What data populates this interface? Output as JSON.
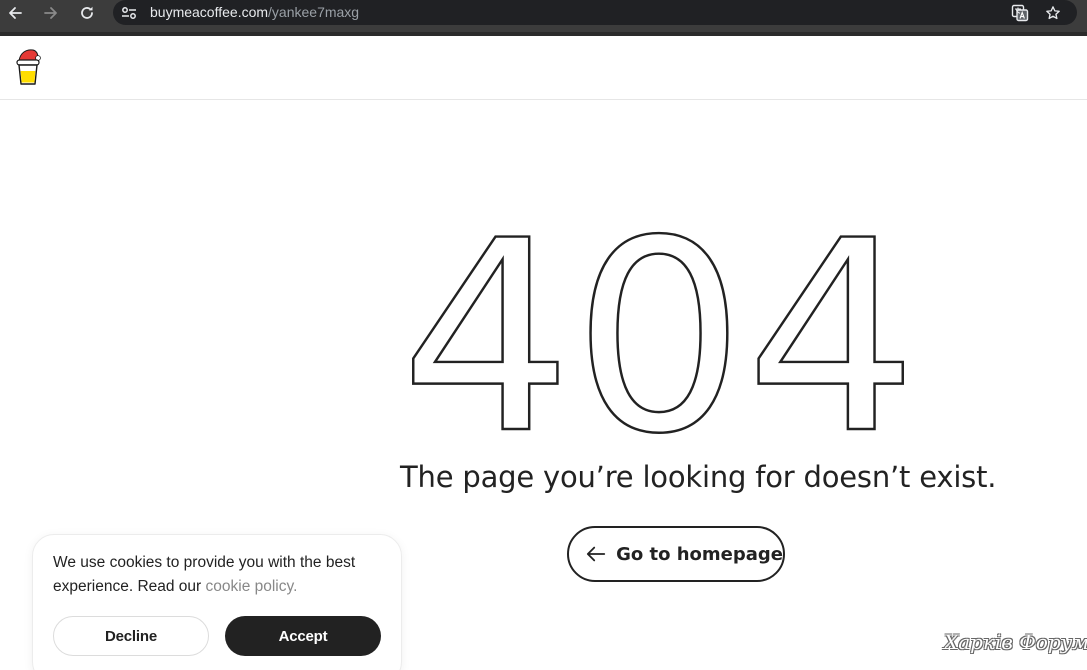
{
  "browser": {
    "url_host": "buymeacoffee.com",
    "url_path": "/yankee7maxg"
  },
  "error": {
    "code": "404",
    "message": "The page you’re looking for doesn’t exist.",
    "home_button_label": "Go to homepage"
  },
  "cookie_banner": {
    "text": "We use cookies to provide you with the best experience. Read our ",
    "link_text": "cookie policy.",
    "decline_label": "Decline",
    "accept_label": "Accept"
  },
  "watermark": {
    "text": "Харків Форум"
  },
  "icons": {
    "back": "arrow-left-icon",
    "forward": "arrow-right-icon",
    "reload": "reload-icon",
    "site_info": "tune-icon",
    "translate": "translate-icon",
    "bookmark": "star-icon",
    "home_arrow": "arrow-left-icon",
    "logo": "coffee-cup-logo"
  },
  "colors": {
    "text": "#222222",
    "link": "#888888",
    "accept_bg": "#222222",
    "chrome_bg": "#3c3c3c",
    "omnibox_bg": "#202124"
  }
}
